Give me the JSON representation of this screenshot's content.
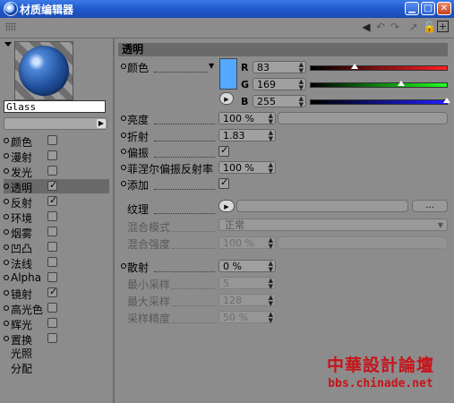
{
  "window": {
    "title": "材质编辑器"
  },
  "material": {
    "name": "Glass",
    "preview_color": "#53a9ff"
  },
  "channels": [
    {
      "label": "颜色",
      "checked": false
    },
    {
      "label": "漫射",
      "checked": false
    },
    {
      "label": "发光",
      "checked": false
    },
    {
      "label": "透明",
      "checked": true,
      "selected": true
    },
    {
      "label": "反射",
      "checked": true
    },
    {
      "label": "环境",
      "checked": false
    },
    {
      "label": "烟雾",
      "checked": false
    },
    {
      "label": "凹凸",
      "checked": false
    },
    {
      "label": "法线",
      "checked": false
    },
    {
      "label": "Alpha",
      "checked": false
    },
    {
      "label": "镜射",
      "checked": true
    },
    {
      "label": "高光色",
      "checked": false
    },
    {
      "label": "辉光",
      "checked": false
    },
    {
      "label": "置换",
      "checked": false
    }
  ],
  "extra_items": [
    "光照",
    "分配"
  ],
  "section": {
    "title": "透明"
  },
  "color": {
    "label": "颜色",
    "r_label": "R",
    "r_value": "83",
    "g_label": "G",
    "g_value": "169",
    "b_label": "B",
    "b_value": "255",
    "r_fraction": 0.325,
    "g_fraction": 0.663,
    "b_fraction": 1.0
  },
  "brightness": {
    "label": "亮度",
    "value": "100 %"
  },
  "refraction": {
    "label": "折射",
    "value": "1.83"
  },
  "polarize": {
    "label": "偏振",
    "checked": true
  },
  "fresnel": {
    "label": "菲涅尔偏振反射率",
    "value": "100 %"
  },
  "additive": {
    "label": "添加",
    "checked": true
  },
  "texture": {
    "label": "纹理",
    "button_label": "..."
  },
  "blend_mode": {
    "label": "混合模式",
    "value": "正常"
  },
  "blend_strength": {
    "label": "混合强度",
    "value": "100 %"
  },
  "blur": {
    "label": "散射",
    "value": "0 %"
  },
  "min_samples": {
    "label": "最小采样",
    "value": "5"
  },
  "max_samples": {
    "label": "最大采样",
    "value": "128"
  },
  "sample_accuracy": {
    "label": "采样精度",
    "value": "50 %"
  },
  "watermark": {
    "title": "中華設計論壇",
    "url": "bbs.chinade.net"
  }
}
